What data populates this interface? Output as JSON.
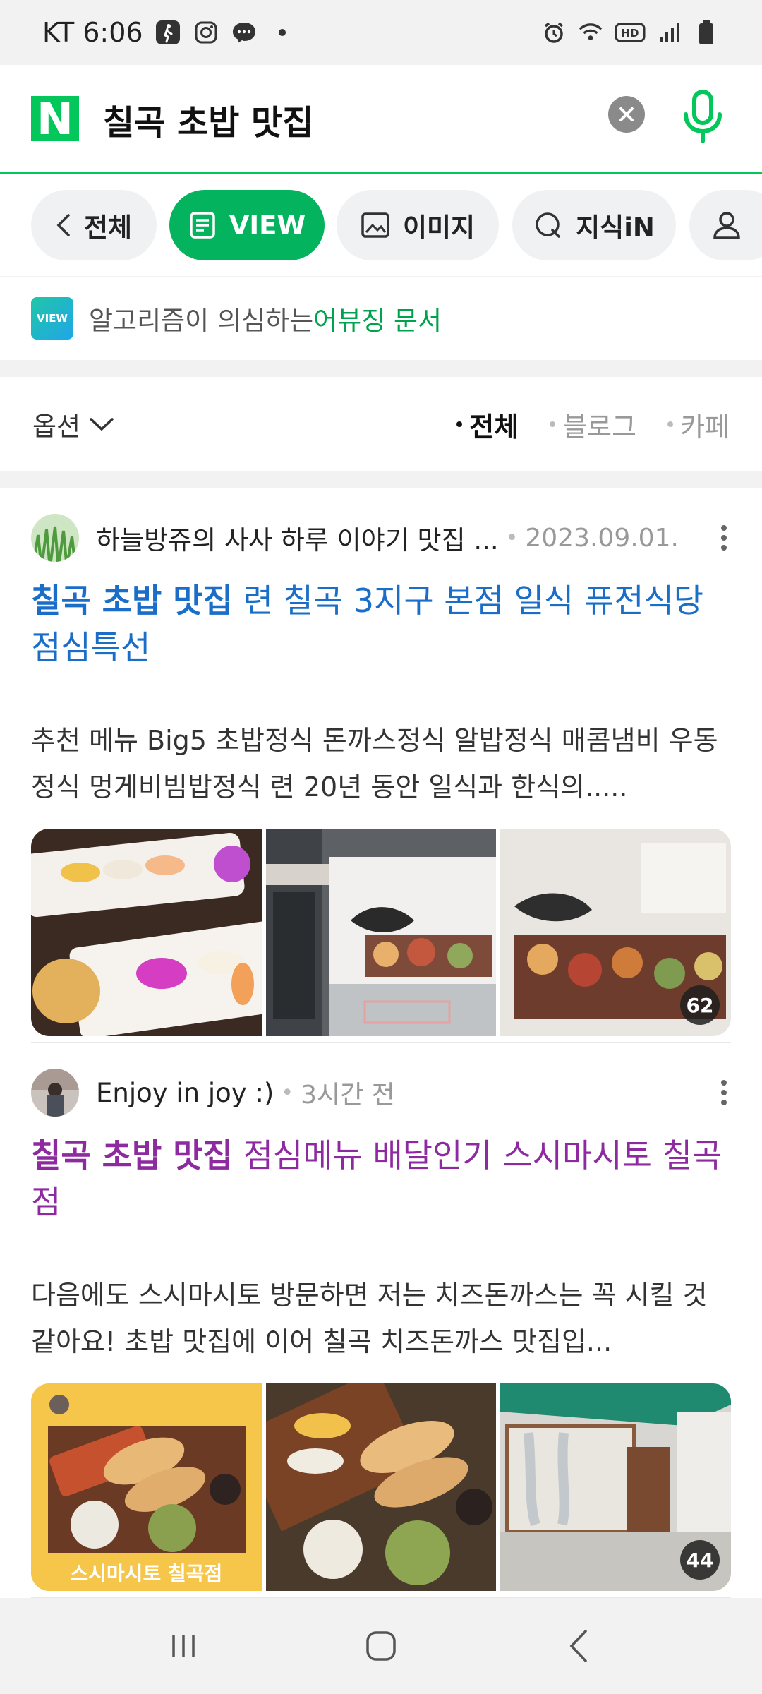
{
  "status_bar": {
    "carrier_time": "KT 6:06",
    "hd_label": "HD"
  },
  "search": {
    "logo": "N",
    "query": "칠곡 초밥 맛집"
  },
  "tabs": [
    {
      "label": "전체"
    },
    {
      "label": "VIEW",
      "active": true
    },
    {
      "label": "이미지"
    },
    {
      "label": "지식iN"
    }
  ],
  "abuse_notice": {
    "badge": "VIEW",
    "text": "알고리즘이 의심하는",
    "link": "어뷰징 문서"
  },
  "options": {
    "label": "옵션",
    "filters": [
      {
        "label": "전체",
        "active": true
      },
      {
        "label": "블로그"
      },
      {
        "label": "카페"
      }
    ]
  },
  "posts": [
    {
      "author": "하늘방쥬의 사사 하루 이야기 맛집 ...",
      "date": "2023.09.01.",
      "title_highlight": "칠곡 초밥 맛집",
      "title_rest": " 련 칠곡 3지구 본점 일식 퓨전식당 점심특선",
      "title_color": "#1a6ec7",
      "snippet": "추천 메뉴 Big5 초밥정식 돈까스정식 알밥정식 매콤냄비 우동정식 멍게비빔밥정식 련 20년 동안 일식과 한식의.....",
      "photo_count": "62"
    },
    {
      "author": "Enjoy in joy :)",
      "date": "3시간 전",
      "title_highlight": "칠곡 초밥 맛집",
      "title_rest": " 점심메뉴 배달인기 스시마시토 칠곡점",
      "title_color": "#8e2aa0",
      "snippet": "다음에도 스시마시토 방문하면 저는 치즈돈까스는 꼭 시킬 것 같아요! 초밥 맛집에 이어 칠곡 치즈돈까스 맛집입...",
      "photo_count": "44",
      "thumb_caption": "스시마시토 칠곡점"
    }
  ]
}
